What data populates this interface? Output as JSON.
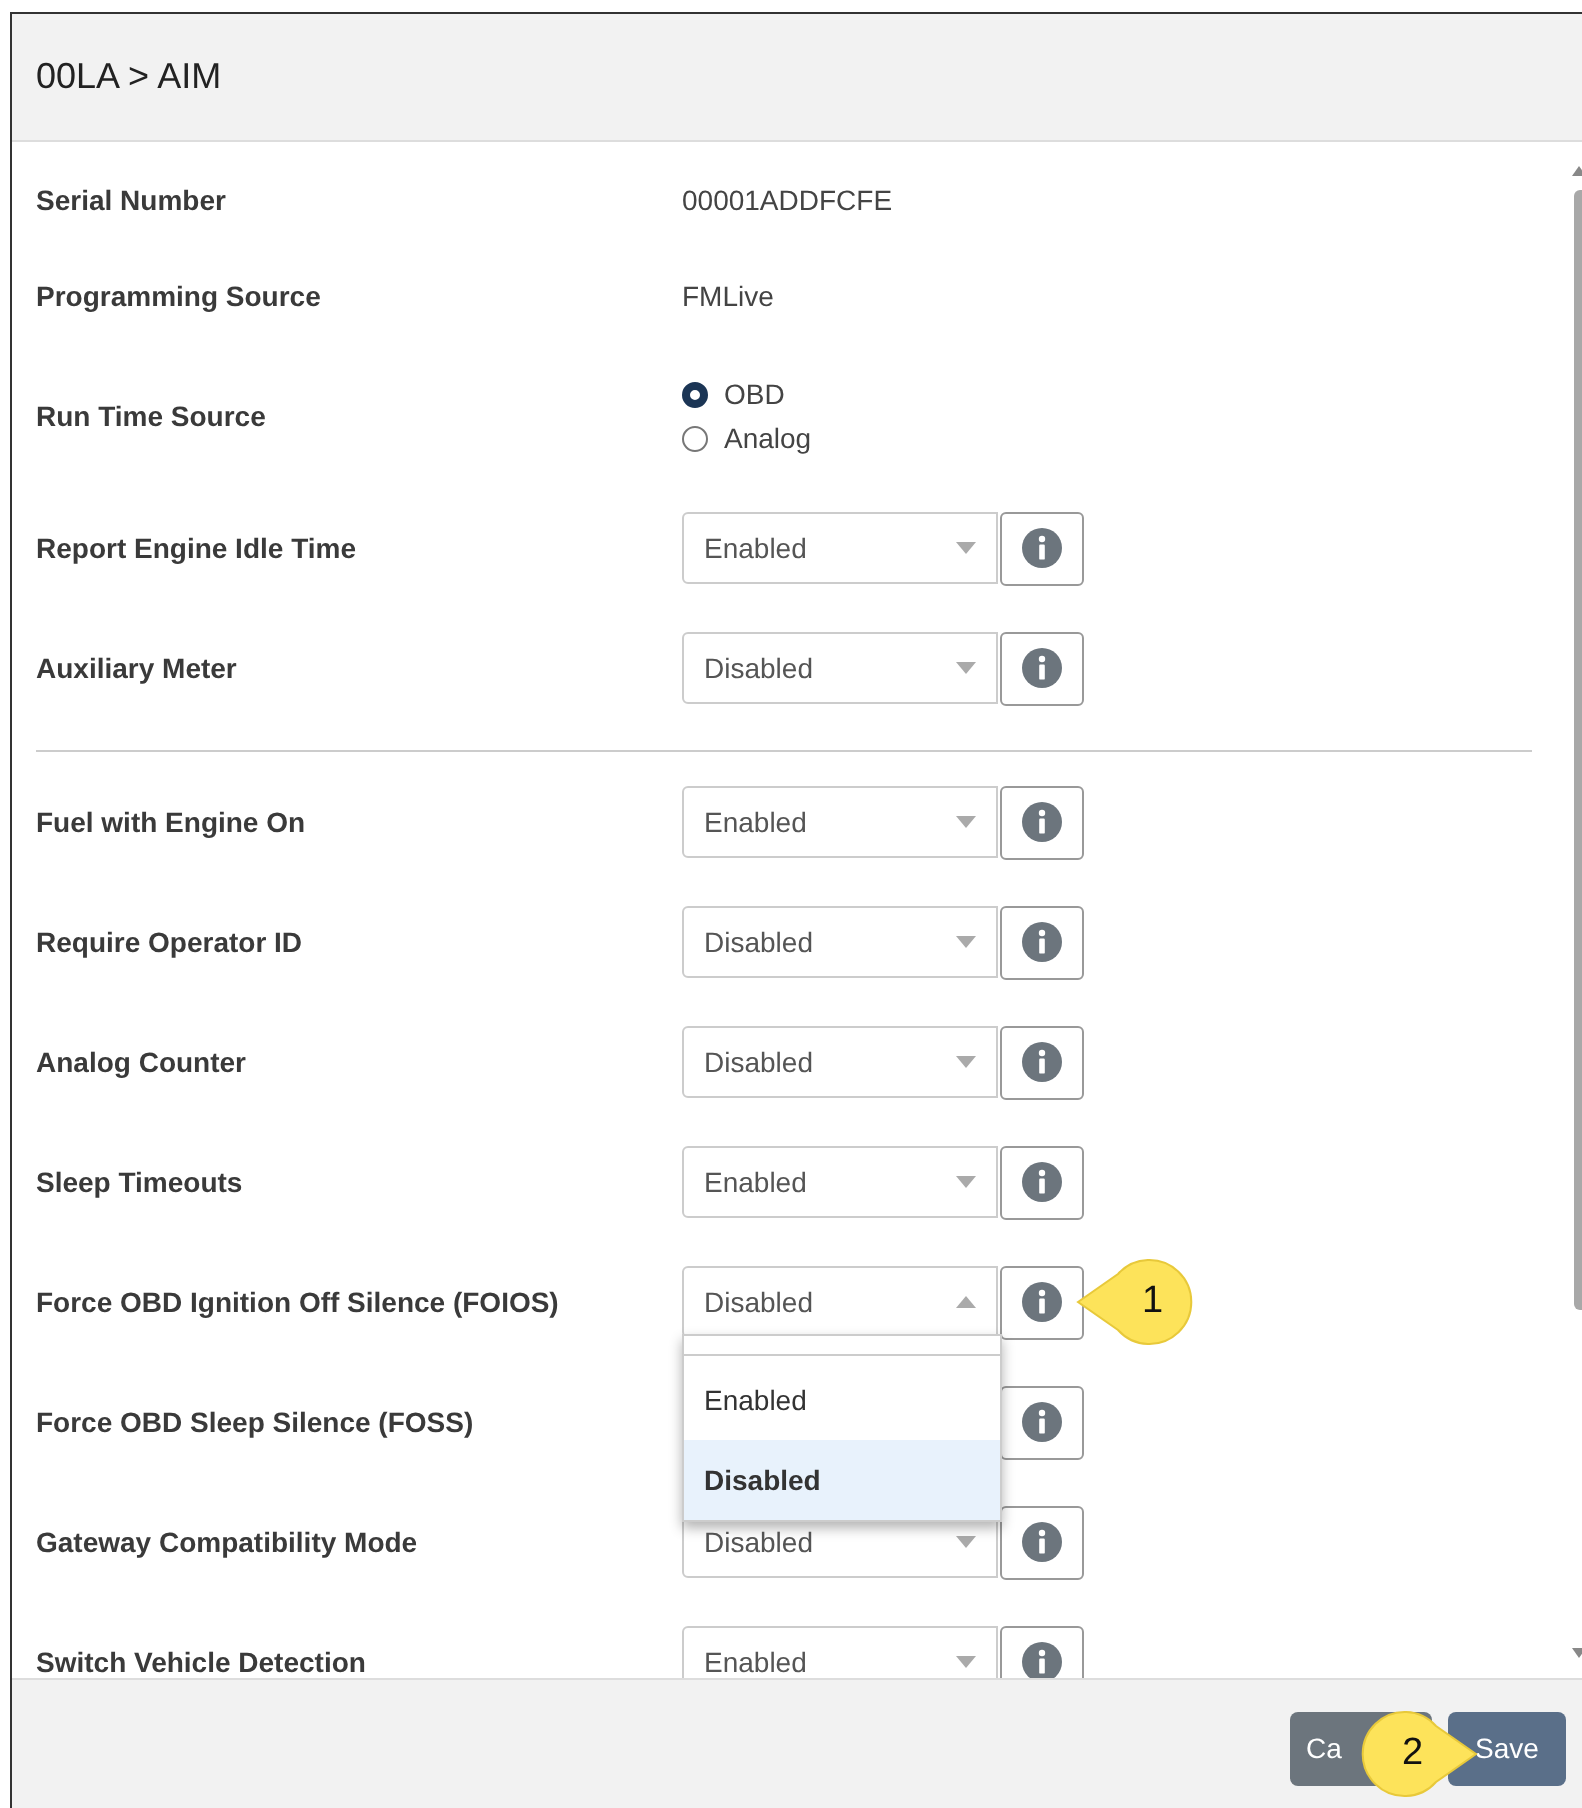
{
  "header": {
    "title": "00LA > AIM"
  },
  "rows": [
    {
      "kind": "text",
      "label": "Serial Number",
      "value": "00001ADDFCFE"
    },
    {
      "kind": "text",
      "label": "Programming Source",
      "value": "FMLive"
    },
    {
      "kind": "radio",
      "label": "Run Time Source",
      "options": [
        {
          "label": "OBD",
          "selected": true
        },
        {
          "label": "Analog",
          "selected": false
        }
      ]
    },
    {
      "kind": "select",
      "label": "Report Engine Idle Time",
      "value": "Enabled"
    },
    {
      "kind": "select",
      "label": "Auxiliary Meter",
      "value": "Disabled"
    },
    {
      "kind": "divider"
    },
    {
      "kind": "select",
      "label": "Fuel with Engine On",
      "value": "Enabled"
    },
    {
      "kind": "select",
      "label": "Require Operator ID",
      "value": "Disabled"
    },
    {
      "kind": "select",
      "label": "Analog Counter",
      "value": "Disabled"
    },
    {
      "kind": "select",
      "label": "Sleep Timeouts",
      "value": "Enabled"
    },
    {
      "kind": "select",
      "label": "Force OBD Ignition Off Silence (FOIOS)",
      "value": "Disabled",
      "open": true,
      "callout": "1",
      "options": [
        {
          "label": "Enabled",
          "selected": false
        },
        {
          "label": "Disabled",
          "selected": true
        }
      ]
    },
    {
      "kind": "select",
      "label": "Force OBD Sleep Silence (FOSS)"
    },
    {
      "kind": "select",
      "label": "Gateway Compatibility Mode",
      "value": "Disabled"
    },
    {
      "kind": "select",
      "label": "Switch Vehicle Detection",
      "value": "Enabled"
    }
  ],
  "footer": {
    "buttons": [
      {
        "kind": "secondary",
        "label": "Ca"
      },
      {
        "kind": "primary",
        "label": "Save"
      }
    ],
    "callout": "2"
  }
}
